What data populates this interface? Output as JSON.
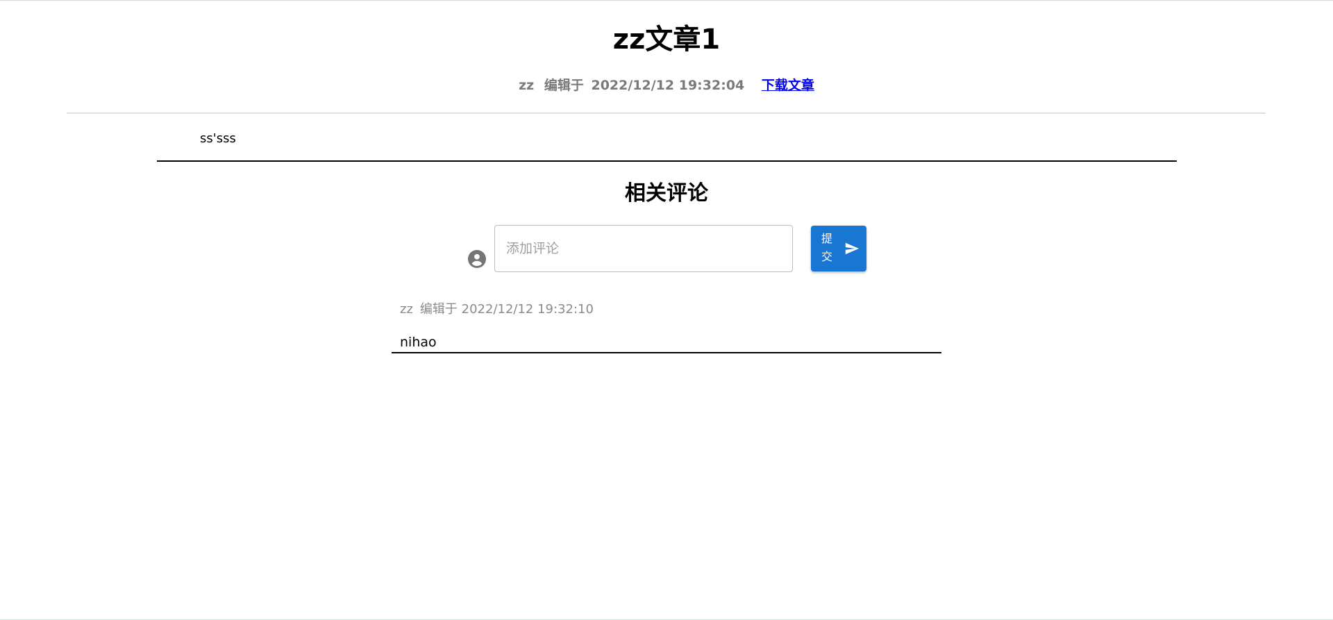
{
  "article": {
    "title": "zz文章1",
    "author": "zz",
    "edited_label": "编辑于",
    "edited_time": "2022/12/12 19:32:04",
    "download_label": "下载文章",
    "body": "ss'sss"
  },
  "comments_section": {
    "title": "相关评论",
    "input_placeholder": "添加评论",
    "submit_label": "提交",
    "avatar_icon": "account-circle-icon",
    "send_icon": "send-icon",
    "accent_color": "#1976d2"
  },
  "comments": [
    {
      "author": "zz",
      "edited_label": "编辑于",
      "time": "2022/12/12 19:32:10",
      "text": "nihao"
    }
  ]
}
